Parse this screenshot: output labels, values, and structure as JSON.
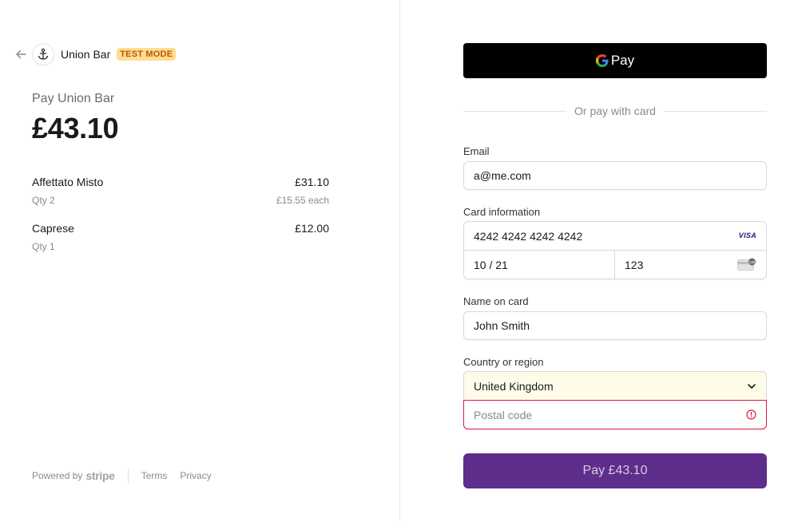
{
  "merchant": {
    "name": "Union Bar",
    "badge": "TEST MODE",
    "pay_label": "Pay Union Bar",
    "amount": "£43.10"
  },
  "items": [
    {
      "name": "Affettato Misto",
      "price": "£31.10",
      "qty": "Qty 2",
      "each": "£15.55 each"
    },
    {
      "name": "Caprese",
      "price": "£12.00",
      "qty": "Qty 1",
      "each": ""
    }
  ],
  "footer": {
    "powered_by": "Powered by",
    "stripe": "stripe",
    "terms": "Terms",
    "privacy": "Privacy"
  },
  "wallet": {
    "gpay_label": "Pay",
    "or_text": "Or pay with card"
  },
  "form": {
    "email_label": "Email",
    "email_value": "a@me.com",
    "card_label": "Card information",
    "card_number": "4242 4242 4242 4242",
    "card_brand": "VISA",
    "card_expiry": "10 / 21",
    "card_cvc": "123",
    "cvc_badge": "135",
    "name_label": "Name on card",
    "name_value": "John Smith",
    "country_label": "Country or region",
    "country_value": "United Kingdom",
    "postal_placeholder": "Postal code",
    "pay_button": "Pay £43.10"
  },
  "colors": {
    "badge_bg": "#ffde92",
    "badge_text": "#bb5504",
    "pay_button_bg": "#5d2e8c",
    "error_red": "#df1b41",
    "country_bg": "#fefbe9"
  },
  "icons": {
    "back": "arrow-left-icon",
    "logo": "anchor-logo-icon",
    "google": "google-g-icon",
    "visa": "visa-icon",
    "cvc": "card-cvc-icon",
    "chevron": "chevron-down-icon",
    "error": "error-icon"
  }
}
